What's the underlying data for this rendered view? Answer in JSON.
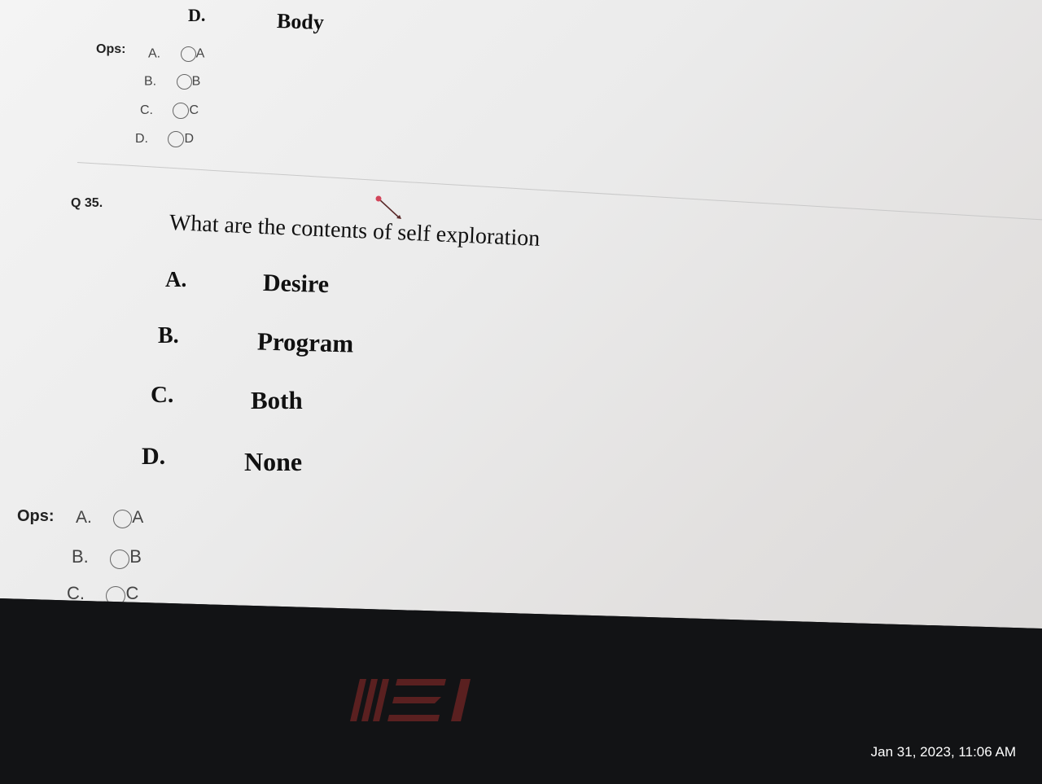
{
  "prev_question": {
    "option_d": {
      "letter": "D.",
      "text": "Body"
    },
    "ops": {
      "label": "Ops:",
      "choices": [
        {
          "letter": "A.",
          "value": "A"
        },
        {
          "letter": "B.",
          "value": "B"
        },
        {
          "letter": "C.",
          "value": "C"
        },
        {
          "letter": "D.",
          "value": "D"
        }
      ]
    }
  },
  "question": {
    "number": "Q 35.",
    "text": "What are the contents of self exploration",
    "options": [
      {
        "letter": "A.",
        "text": "Desire"
      },
      {
        "letter": "B.",
        "text": "Program"
      },
      {
        "letter": "C.",
        "text": "Both"
      },
      {
        "letter": "D.",
        "text": "None"
      }
    ],
    "ops": {
      "label": "Ops:",
      "choices": [
        {
          "letter": "A.",
          "value": "A"
        },
        {
          "letter": "B.",
          "value": "B"
        },
        {
          "letter": "C.",
          "value": "C"
        }
      ]
    }
  },
  "brand_logo": "MSI",
  "photo_timestamp": "Jan 31, 2023, 11:06 AM",
  "colors": {
    "bezel": "#151618",
    "logo": "#5a2020",
    "screen": "#eeeeee"
  }
}
